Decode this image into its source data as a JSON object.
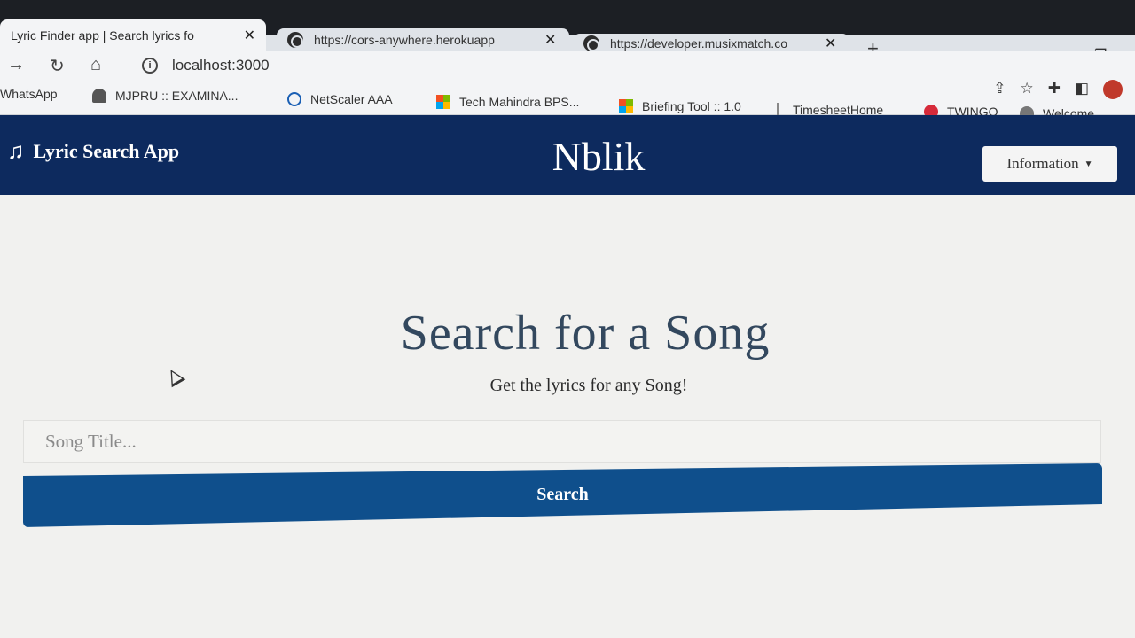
{
  "browser": {
    "tabs": [
      {
        "title": "Lyric Finder app | Search lyrics fo",
        "close": "✕",
        "active": true
      },
      {
        "title": "https://cors-anywhere.herokuapp",
        "close": "✕",
        "active": false
      },
      {
        "title": "https://developer.musixmatch.co",
        "close": "✕",
        "active": false
      }
    ],
    "new_tab": "+",
    "address": "localhost:3000",
    "bookmarks": [
      {
        "label": "WhatsApp"
      },
      {
        "label": "MJPRU :: EXAMINA..."
      },
      {
        "label": "NetScaler AAA"
      },
      {
        "label": "Tech Mahindra BPS..."
      },
      {
        "label": "Briefing Tool :: 1.0"
      },
      {
        "label": "TimesheetHome"
      },
      {
        "label": "TWINGO"
      },
      {
        "label": "Welcome"
      }
    ]
  },
  "navbar": {
    "brand": "Lyric Search App",
    "center_title": "Nblik",
    "info_button": "Information"
  },
  "hero": {
    "title": "Search for a Song",
    "subtitle": "Get the lyrics for any Song!",
    "input_placeholder": "Song Title...",
    "search_button": "Search"
  },
  "colors": {
    "navbar_bg": "#0d2a5e",
    "button_bg": "#0f4f8c",
    "page_bg": "#f1f1ef"
  }
}
